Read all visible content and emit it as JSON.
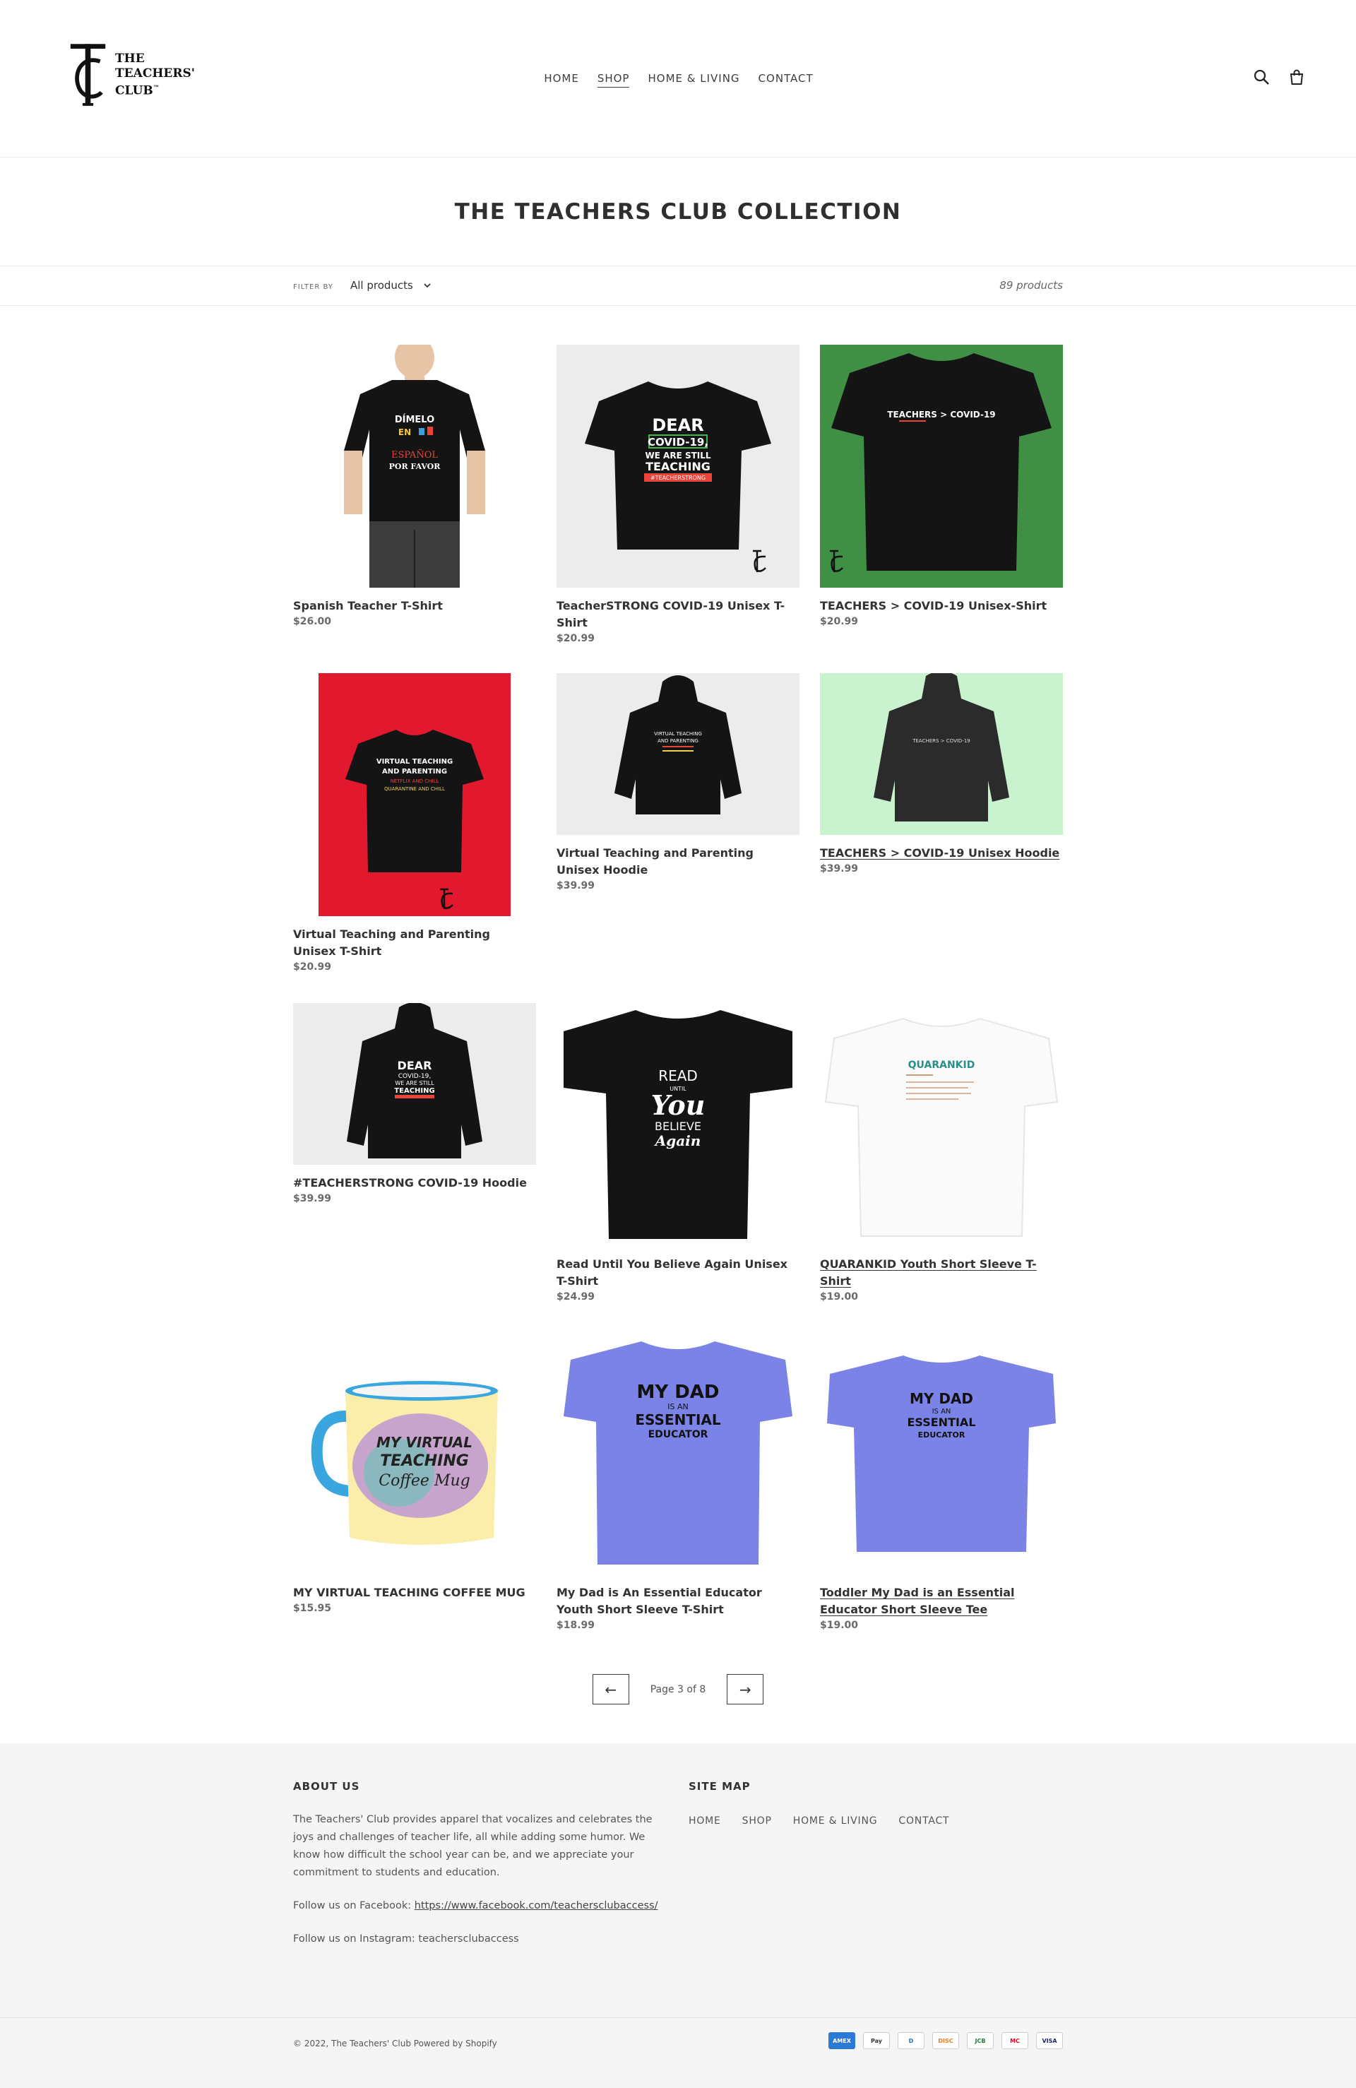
{
  "header": {
    "logo_lines": [
      "THE",
      "TEACHERS'",
      "CLUB"
    ],
    "logo_tm": "™",
    "nav": [
      {
        "label": "HOME",
        "active": false
      },
      {
        "label": "SHOP",
        "active": true
      },
      {
        "label": "HOME & LIVING",
        "active": false
      },
      {
        "label": "CONTACT",
        "active": false
      }
    ]
  },
  "collection": {
    "title": "THE TEACHERS CLUB COLLECTION",
    "filter_label": "FILTER BY",
    "filter_value": "All products",
    "product_count": "89 products"
  },
  "products": [
    {
      "name": "Spanish Teacher T-Shirt",
      "price": "$26.00",
      "shirt_text": [
        "DÍMELO",
        "EN",
        "ESPAÑOL",
        "POR FAVOR"
      ]
    },
    {
      "name": "TeacherSTRONG COVID-19 Unisex T-Shirt",
      "price": "$20.99",
      "shirt_text": [
        "DEAR",
        "COVID-19,",
        "WE ARE STILL",
        "TEACHING",
        "#TEACHERSTRONG"
      ]
    },
    {
      "name": "TEACHERS > COVID-19 Unisex-Shirt",
      "price": "$20.99",
      "shirt_text": [
        "TEACHERS > COVID-19"
      ]
    },
    {
      "name": "Virtual Teaching and Parenting Unisex T-Shirt",
      "price": "$20.99",
      "shirt_text": [
        "VIRTUAL TEACHING",
        "AND PARENTING",
        "NETFLIX AND CHILL",
        "QUARANTINE AND CHILL"
      ]
    },
    {
      "name": "Virtual Teaching and Parenting Unisex Hoodie",
      "price": "$39.99",
      "shirt_text": [
        "VIRTUAL TEACHING",
        "AND PARENTING"
      ]
    },
    {
      "name": "TEACHERS > COVID-19 Unisex Hoodie",
      "price": "$39.99",
      "shirt_text": [
        "TEACHERS > COVID-19"
      ]
    },
    {
      "name": "#TEACHERSTRONG COVID-19 Hoodie",
      "price": "$39.99",
      "shirt_text": [
        "DEAR",
        "COVID-19,",
        "WE ARE STILL",
        "TEACHING"
      ]
    },
    {
      "name": "Read Until You Believe Again Unisex T-Shirt",
      "price": "$24.99",
      "shirt_text": [
        "READ",
        "UNTIL",
        "You",
        "BELIEVE",
        "Again"
      ]
    },
    {
      "name": "QUARANKID Youth Short Sleeve T-Shirt",
      "price": "$19.00",
      "shirt_text": [
        "QUARANKID"
      ]
    },
    {
      "name": "MY VIRTUAL TEACHING COFFEE MUG",
      "price": "$15.95",
      "shirt_text": [
        "MY VIRTUAL",
        "TEACHING",
        "Coffee Mug"
      ]
    },
    {
      "name": "My Dad is An Essential Educator Youth Short Sleeve T-Shirt",
      "price": "$18.99",
      "shirt_text": [
        "MY DAD",
        "IS AN",
        "ESSENTIAL",
        "EDUCATOR"
      ]
    },
    {
      "name": "Toddler My Dad is an Essential Educator Short Sleeve Tee",
      "price": "$19.00",
      "shirt_text": [
        "MY DAD",
        "IS AN",
        "ESSENTIAL",
        "EDUCATOR"
      ]
    }
  ],
  "pagination": {
    "prev": "←",
    "next": "→",
    "label": "Page 3 of 8"
  },
  "footer": {
    "about_title": "ABOUT US",
    "about_text": "The Teachers' Club provides apparel that vocalizes and celebrates the joys and challenges of teacher life, all while adding some humor.  We know how difficult the school year can be, and we appreciate your commitment to students and education.",
    "follow_fb_prefix": "Follow us on Facebook: ",
    "follow_fb_link": "https://www.facebook.com/teachersclubaccess/",
    "follow_ig": "Follow us on Instagram: teachersclubaccess",
    "sitemap_title": "SITE MAP",
    "sitemap_links": [
      "HOME",
      "SHOP",
      "HOME & LIVING",
      "CONTACT"
    ],
    "copyright": "© 2022, The Teachers' Club Powered by Shopify",
    "payments": [
      "AMEX",
      "Pay",
      "D",
      "DISC",
      "JCB",
      "MC",
      "VISA"
    ]
  },
  "colors": {
    "green_bg": "#3f9044",
    "red_bg": "#e2182f",
    "mint_bg": "#c9f2cf",
    "shirt_black": "#141414",
    "heather_blue": "#7b83e6"
  }
}
